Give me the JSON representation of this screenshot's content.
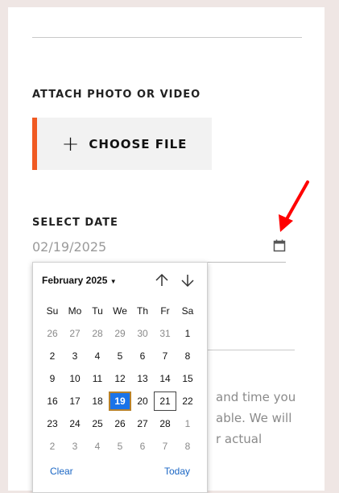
{
  "attach": {
    "label": "ATTACH PHOTO OR VIDEO",
    "button_label": "CHOOSE FILE"
  },
  "date": {
    "label": "SELECT DATE",
    "value": "02/19/2025"
  },
  "background_text": [
    "and time you",
    "able. We will",
    "r actual"
  ],
  "colors": {
    "accent": "#f05a22",
    "selected": "#1a73e8",
    "link": "#1a66c4",
    "arrow": "#ff0000"
  },
  "icons": {
    "calendar": "calendar-icon",
    "up": "arrow-up-icon",
    "down": "arrow-down-icon",
    "dropdown": "triangle-down-icon"
  },
  "calendar": {
    "month_label": "February 2025",
    "weekdays": [
      "Su",
      "Mo",
      "Tu",
      "We",
      "Th",
      "Fr",
      "Sa"
    ],
    "weeks": [
      [
        "26",
        "27",
        "28",
        "29",
        "30",
        "31",
        "1"
      ],
      [
        "2",
        "3",
        "4",
        "5",
        "6",
        "7",
        "8"
      ],
      [
        "9",
        "10",
        "11",
        "12",
        "13",
        "14",
        "15"
      ],
      [
        "16",
        "17",
        "18",
        "19",
        "20",
        "21",
        "22"
      ],
      [
        "23",
        "24",
        "25",
        "26",
        "27",
        "28",
        "1"
      ],
      [
        "2",
        "3",
        "4",
        "5",
        "6",
        "7",
        "8"
      ]
    ],
    "selected_day": "19",
    "today_day": "21",
    "clear_label": "Clear",
    "today_label": "Today"
  }
}
